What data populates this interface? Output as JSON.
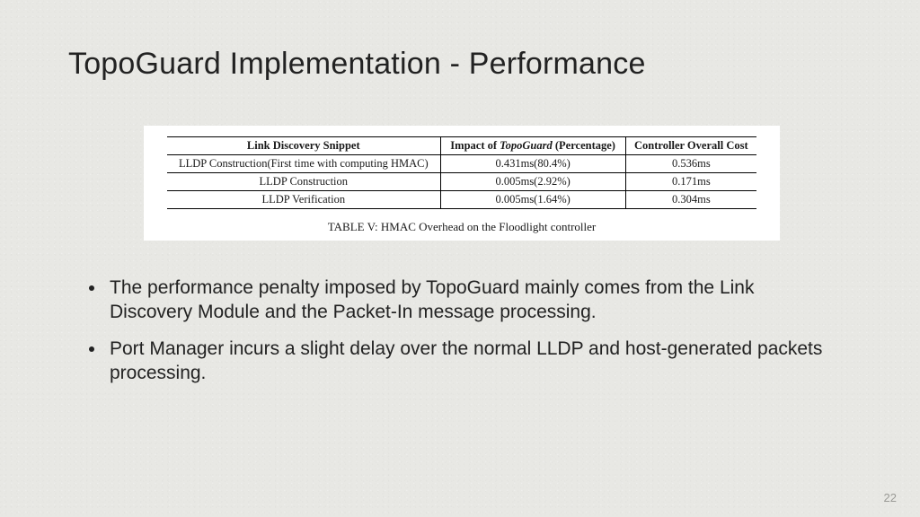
{
  "title": "TopoGuard Implementation - Performance",
  "table": {
    "headers": {
      "c1": "Link Discovery Snippet",
      "c2_a": "Impact of ",
      "c2_b": "TopoGuard",
      "c2_c": " (Percentage)",
      "c3": "Controller Overall Cost"
    },
    "rows": [
      {
        "c1": "LLDP Construction(First time with computing HMAC)",
        "c2": "0.431ms(80.4%)",
        "c3": "0.536ms"
      },
      {
        "c1": "LLDP Construction",
        "c2": "0.005ms(2.92%)",
        "c3": "0.171ms"
      },
      {
        "c1": "LLDP Verification",
        "c2": "0.005ms(1.64%)",
        "c3": "0.304ms"
      }
    ],
    "caption": "TABLE V: HMAC Overhead on the Floodlight controller"
  },
  "bullets": [
    "The performance penalty imposed by TopoGuard mainly comes from the Link Discovery Module and the Packet-In message processing.",
    "Port Manager incurs a slight delay over the normal LLDP and host-generated packets processing."
  ],
  "page_number": "22",
  "chart_data": {
    "type": "table",
    "title": "TABLE V: HMAC Overhead on the Floodlight controller",
    "columns": [
      "Link Discovery Snippet",
      "Impact of TopoGuard (Percentage)",
      "Controller Overall Cost"
    ],
    "rows": [
      [
        "LLDP Construction(First time with computing HMAC)",
        "0.431ms(80.4%)",
        "0.536ms"
      ],
      [
        "LLDP Construction",
        "0.005ms(2.92%)",
        "0.171ms"
      ],
      [
        "LLDP Verification",
        "0.005ms(1.64%)",
        "0.304ms"
      ]
    ]
  }
}
